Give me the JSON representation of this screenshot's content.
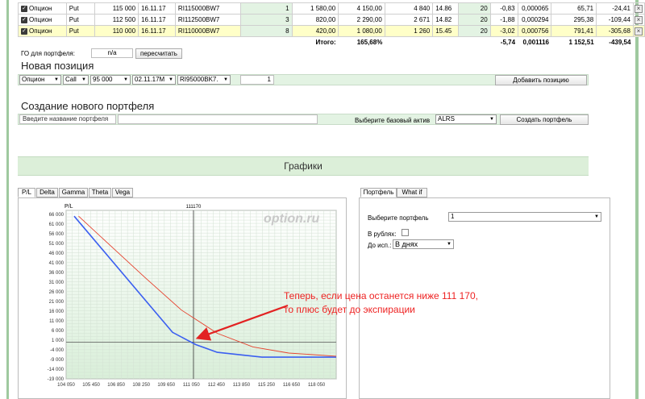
{
  "positions": {
    "rows": [
      {
        "type": "Опцион",
        "kind": "Put",
        "strike": "115 000",
        "date": "16.11.17",
        "code": "RI115000BW7",
        "qty": "1",
        "price": "1 580,00",
        "sum": "4 150,00",
        "bid": "4 840",
        "iv": "14.86",
        "lev": "20",
        "delta": "-0,83",
        "gamma": "0,000065",
        "theta": "65,71",
        "vega": "-24,41"
      },
      {
        "type": "Опцион",
        "kind": "Put",
        "strike": "112 500",
        "date": "16.11.17",
        "code": "RI112500BW7",
        "qty": "3",
        "price": "820,00",
        "sum": "2 290,00",
        "bid": "2 671",
        "iv": "14.82",
        "lev": "20",
        "delta": "-1,88",
        "gamma": "0,000294",
        "theta": "295,38",
        "vega": "-109,44"
      },
      {
        "type": "Опцион",
        "kind": "Put",
        "strike": "110 000",
        "date": "16.11.17",
        "code": "RI110000BW7",
        "qty": "8",
        "price": "420,00",
        "sum": "1 080,00",
        "bid": "1 260",
        "iv": "15.45",
        "lev": "20",
        "delta": "-3,02",
        "gamma": "0,000756",
        "theta": "791,41",
        "vega": "-305,68"
      }
    ],
    "totals": {
      "label": "Итого:",
      "pct": "165,68%",
      "delta": "-5,74",
      "gamma": "0,001116",
      "theta": "1 152,51",
      "vega": "-439,54"
    }
  },
  "margin": {
    "label": "ГО для портфеля:",
    "value": "n/a",
    "recalc": "пересчитать"
  },
  "new_position": {
    "title": "Новая позиция",
    "type": "Опцион",
    "kind": "Call",
    "strike": "95 000",
    "date": "02.11.17M",
    "code": "RI95000BK7.",
    "qty": "1",
    "add_button": "Добавить позицию"
  },
  "new_portfolio": {
    "title": "Создание нового портфеля",
    "name_placeholder": "Введите название портфеля",
    "asset_label": "Выберите базовый актив",
    "asset_value": "ALRS",
    "create_button": "Создать портфель"
  },
  "charts": {
    "section_title": "Графики",
    "tabs": [
      "P/L",
      "Delta",
      "Gamma",
      "Theta",
      "Vega"
    ],
    "side_tabs": [
      "Портфель",
      "What if"
    ],
    "portfolio_label": "Выберите портфель",
    "portfolio_value": "1",
    "rub_label": "В рублях:",
    "until_label": "До исп.:",
    "until_value": "В днях",
    "watermark": "option.ru",
    "annotation_line1": "Теперь, если цена останется ниже 111 170,",
    "annotation_line2": "то плюс будет до экспирации"
  },
  "chart_data": {
    "type": "line",
    "ylabel": "P/L",
    "marker_label": "111170",
    "marker_x": 111170,
    "xlim": [
      104050,
      119150
    ],
    "ylim": [
      -19000,
      68000
    ],
    "xticks": [
      104050,
      105450,
      106850,
      108250,
      109650,
      111050,
      112450,
      113850,
      115250,
      116650,
      118050
    ],
    "yticks": [
      66000,
      61000,
      56000,
      51000,
      46000,
      41000,
      36000,
      31000,
      26000,
      21000,
      16000,
      11000,
      6000,
      1000,
      -4000,
      -9000,
      -14000,
      -19000
    ],
    "series": [
      {
        "color": "#3b5ff0",
        "x": [
          104500,
          110000,
          111300,
          112500,
          115000,
          119150
        ],
        "y": [
          65000,
          5000,
          -1300,
          -5300,
          -7800,
          -7800
        ]
      },
      {
        "color": "#e6412d",
        "x": [
          104750,
          106500,
          108500,
          110500,
          112500,
          114500,
          116500,
          119150
        ],
        "y": [
          65000,
          50000,
          33000,
          16500,
          4500,
          -2500,
          -5700,
          -7300
        ]
      }
    ],
    "colors": {
      "accent": "#dcefd9",
      "annotation": "#e22222",
      "arrow": "#e22222"
    }
  }
}
